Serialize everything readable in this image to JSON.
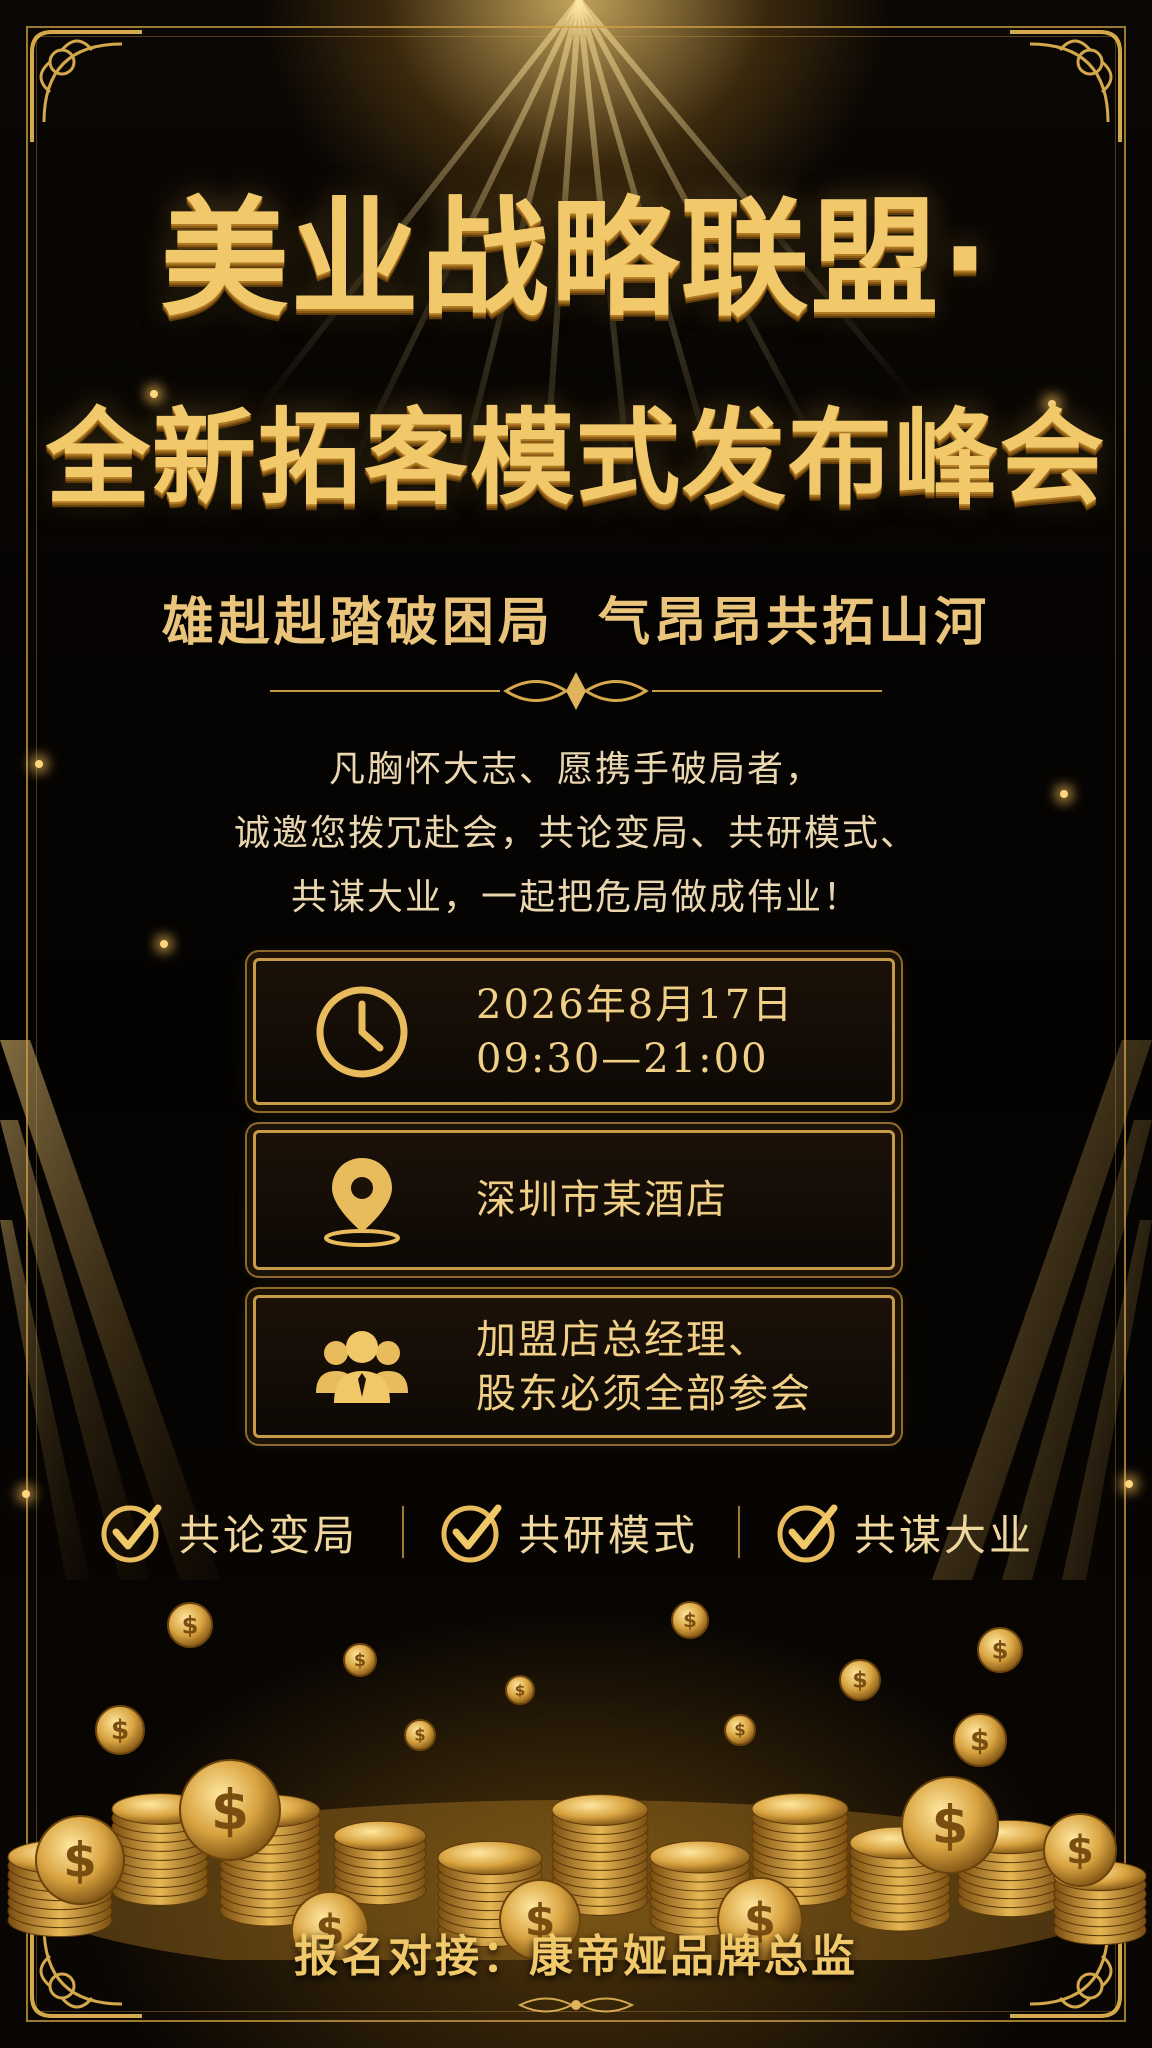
{
  "title": {
    "line1": "美业战略联盟·",
    "line2": "全新拓客模式发布峰会"
  },
  "slogan": "雄赳赳踏破困局  气昂昂共拓山河",
  "intro": [
    "凡胸怀大志、愿携手破局者，",
    "诚邀您拨冗赴会，共论变局、共研模式、",
    "共谋大业，一起把危局做成伟业！"
  ],
  "info": {
    "date": "2026年8月17日",
    "time": "09:30—21:00",
    "venue": "深圳市某酒店",
    "attendees_line1": "加盟店总经理、",
    "attendees_line2": "股东必须全部参会"
  },
  "features": [
    "共论变局",
    "共研模式",
    "共谋大业"
  ],
  "footer": "报名对接：康帝娅品牌总监",
  "colors": {
    "gold": "#f1c96a",
    "dark_gold": "#c79b45",
    "background": "#050302"
  },
  "icons": [
    "clock-icon",
    "location-pin-icon",
    "people-group-icon",
    "check-icon"
  ]
}
